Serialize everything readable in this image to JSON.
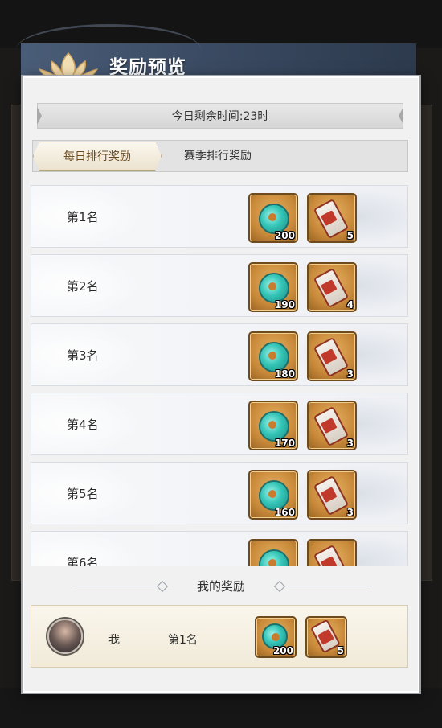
{
  "header": {
    "title": "奖励预览"
  },
  "timer": {
    "text": "今日剩余时间:23时"
  },
  "tabs": [
    {
      "label": "每日排行奖励",
      "active": true
    },
    {
      "label": "赛季排行奖励",
      "active": false
    }
  ],
  "rank_rewards": [
    {
      "rank": "第1名",
      "items": [
        {
          "icon": "teal-gem-icon",
          "count": "200"
        },
        {
          "icon": "scroll-icon",
          "count": "5"
        }
      ]
    },
    {
      "rank": "第2名",
      "items": [
        {
          "icon": "teal-gem-icon",
          "count": "190"
        },
        {
          "icon": "scroll-icon",
          "count": "4"
        }
      ]
    },
    {
      "rank": "第3名",
      "items": [
        {
          "icon": "teal-gem-icon",
          "count": "180"
        },
        {
          "icon": "scroll-icon",
          "count": "3"
        }
      ]
    },
    {
      "rank": "第4名",
      "items": [
        {
          "icon": "teal-gem-icon",
          "count": "170"
        },
        {
          "icon": "scroll-icon",
          "count": "3"
        }
      ]
    },
    {
      "rank": "第5名",
      "items": [
        {
          "icon": "teal-gem-icon",
          "count": "160"
        },
        {
          "icon": "scroll-icon",
          "count": "3"
        }
      ]
    },
    {
      "rank": "第6名",
      "items": [
        {
          "icon": "teal-gem-icon",
          "count": ""
        },
        {
          "icon": "scroll-icon",
          "count": ""
        }
      ]
    }
  ],
  "my_reward": {
    "section_title": "我的奖励",
    "name": "我",
    "rank": "第1名",
    "items": [
      {
        "icon": "teal-gem-icon",
        "count": "200"
      },
      {
        "icon": "scroll-icon",
        "count": "5"
      }
    ]
  },
  "colors": {
    "item_frame": "#c98a3a",
    "header": "#3b4b63",
    "active_tab_text": "#6b4a22"
  }
}
